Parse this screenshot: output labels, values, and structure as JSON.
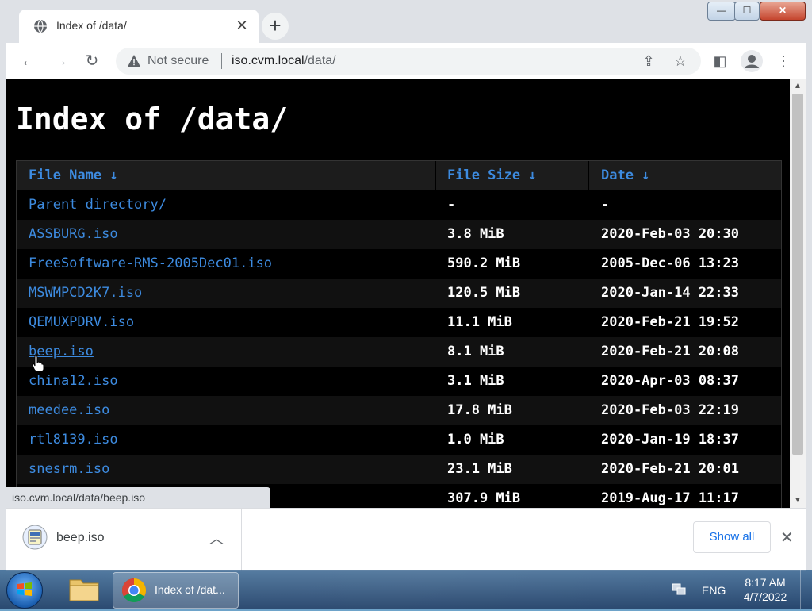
{
  "browser": {
    "tab_title": "Index of /data/",
    "tab_close": "✕",
    "new_tab": "+",
    "not_secure": "Not secure",
    "url_host": "iso.cvm.local",
    "url_path": "/data/",
    "window_buttons": {
      "minimize": "—",
      "maximize": "☐",
      "close": "✕"
    }
  },
  "page": {
    "heading": "Index of /data/",
    "columns": {
      "name": "File Name  ↓",
      "size": "File Size  ↓",
      "date": "Date  ↓"
    },
    "rows": [
      {
        "name": "Parent directory/",
        "size": "-",
        "date": "-"
      },
      {
        "name": "ASSBURG.iso",
        "size": "3.8 MiB",
        "date": "2020-Feb-03 20:30"
      },
      {
        "name": "FreeSoftware-RMS-2005Dec01.iso",
        "size": "590.2 MiB",
        "date": "2005-Dec-06 13:23"
      },
      {
        "name": "MSWMPCD2K7.iso",
        "size": "120.5 MiB",
        "date": "2020-Jan-14 22:33"
      },
      {
        "name": "QEMUXPDRV.iso",
        "size": "11.1 MiB",
        "date": "2020-Feb-21 19:52"
      },
      {
        "name": "beep.iso",
        "size": "8.1 MiB",
        "date": "2020-Feb-21 20:08"
      },
      {
        "name": "china12.iso",
        "size": "3.1 MiB",
        "date": "2020-Apr-03 08:37"
      },
      {
        "name": "meedee.iso",
        "size": "17.8 MiB",
        "date": "2020-Feb-03 22:19"
      },
      {
        "name": "rtl8139.iso",
        "size": "1.0 MiB",
        "date": "2020-Jan-19 18:37"
      },
      {
        "name": "snesrm.iso",
        "size": "23.1 MiB",
        "date": "2020-Feb-21 20:01"
      },
      {
        "name": "",
        "size": "307.9 MiB",
        "date": "2019-Aug-17 11:17"
      }
    ]
  },
  "status_url": "iso.cvm.local/data/beep.iso",
  "downloads": {
    "item_name": "beep.iso",
    "show_all": "Show all",
    "close": "✕"
  },
  "taskbar": {
    "chrome_label": "Index of /dat...",
    "language": "ENG",
    "time": "8:17 AM",
    "date": "4/7/2022"
  },
  "colors": {
    "link": "#3d8be0",
    "page_bg": "#000000",
    "accent": "#1a73e8"
  }
}
